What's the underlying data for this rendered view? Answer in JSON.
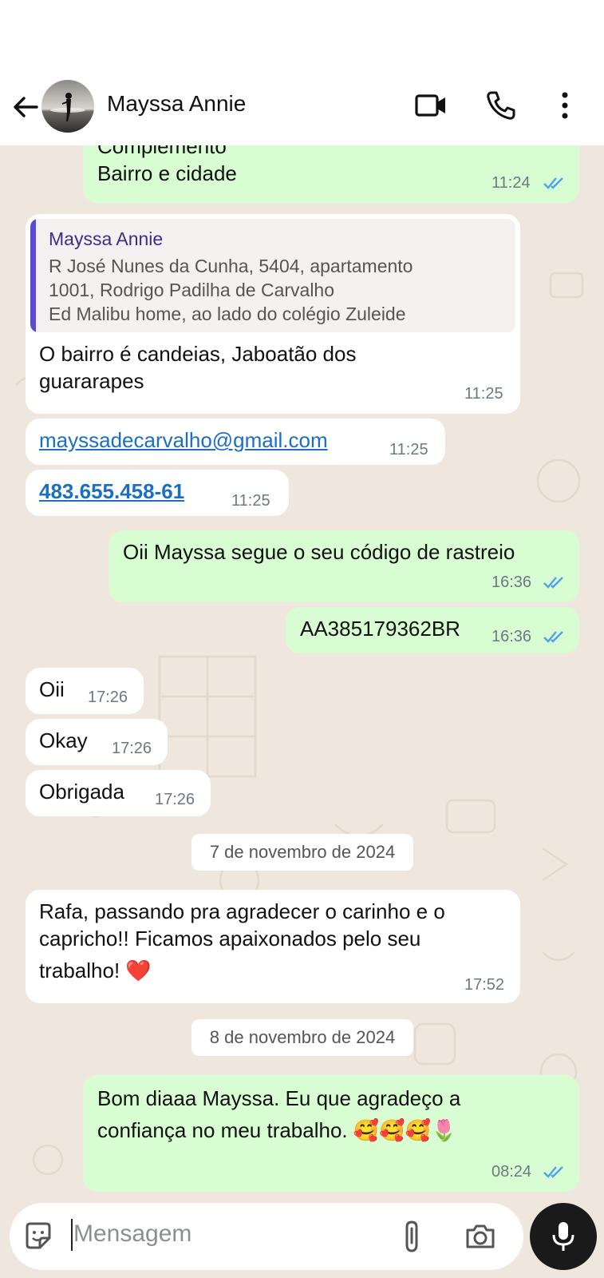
{
  "header": {
    "contact_name": "Mayssa Annie",
    "icons": [
      "back-arrow-icon",
      "video-call-icon",
      "voice-call-icon",
      "more-options-icon"
    ]
  },
  "messages": {
    "m0": {
      "lines": [
        "Complemento",
        "Bairro e cidade"
      ],
      "time": "11:24"
    },
    "m1": {
      "quote_name": "Mayssa Annie",
      "quote_lines": [
        "R José Nunes da Cunha, 5404, apartamento",
        "1001, Rodrigo Padilha de Carvalho",
        "Ed Malibu home, ao lado do colégio Zuleide"
      ],
      "lines": [
        "O bairro é candeias, Jaboatão dos",
        "guararapes"
      ],
      "time": "11:25"
    },
    "m2": {
      "text": "mayssadecarvalho@gmail.com",
      "time": "11:25"
    },
    "m3": {
      "text": "483.655.458-61",
      "time": "11:25"
    },
    "m4": {
      "text": "Oii Mayssa segue o seu código de rastreio",
      "time": "16:36"
    },
    "m5": {
      "text": "AA385179362BR",
      "time": "16:36"
    },
    "m6": {
      "text": "Oii",
      "time": "17:26"
    },
    "m7": {
      "text": "Okay",
      "time": "17:26"
    },
    "m8": {
      "text": "Obrigada",
      "time": "17:26"
    },
    "date1": "7 de novembro de 2024",
    "m9": {
      "lines": [
        "Rafa, passando pra agradecer o carinho e o",
        "capricho!! Ficamos apaixonados pelo seu",
        "trabalho! ❤️"
      ],
      "time": "17:52"
    },
    "date2": "8 de novembro de 2024",
    "m10": {
      "lines": [
        "Bom diaaa Mayssa. Eu que agradeço a",
        "confiança no meu trabalho. 🥰🥰🥰🌷"
      ],
      "time": "08:24"
    }
  },
  "composer": {
    "placeholder": "Mensagem",
    "icons": [
      "sticker-icon",
      "attach-icon",
      "camera-icon",
      "microphone-icon"
    ]
  },
  "colors": {
    "incoming_bubble": "#ffffff",
    "outgoing_bubble": "#d9fdd3",
    "chat_background": "#efe7dd",
    "read_ticks": "#4fa3e6",
    "link": "#1b6fc2",
    "quote_bar": "#5b4bd0"
  }
}
